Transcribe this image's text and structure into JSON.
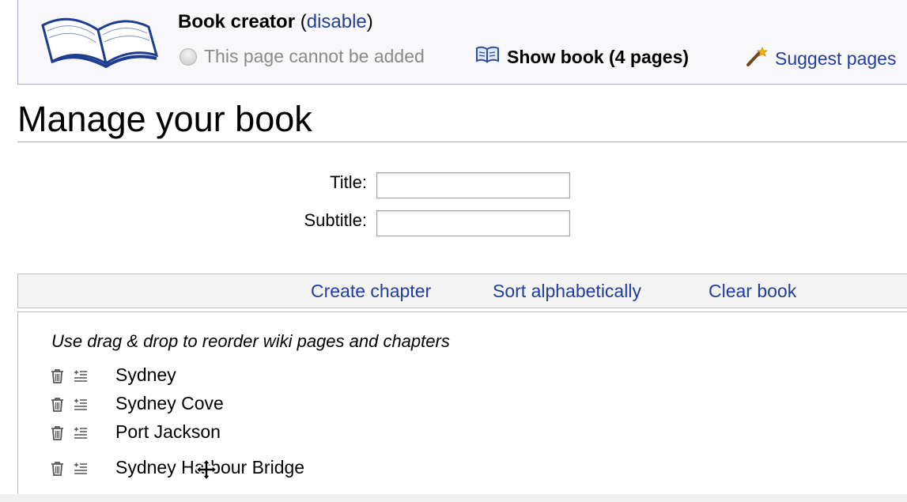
{
  "book_creator": {
    "title": "Book creator",
    "disable_open": "(",
    "disable_link": "disable",
    "disable_close": ")",
    "cannot_add_text": "This page cannot be added",
    "show_book_label": "Show book (4 pages)",
    "suggest_pages_label": "Suggest pages",
    "icons": {
      "logo": "open-book-icon",
      "radio": "radio-disabled-icon",
      "show_book": "book-icon",
      "suggest": "magic-wand-icon"
    }
  },
  "heading": "Manage your book",
  "form": {
    "title_label": "Title:",
    "title_value": "",
    "subtitle_label": "Subtitle:",
    "subtitle_value": ""
  },
  "toolbar": {
    "create_chapter": "Create chapter",
    "sort_alphabetically": "Sort alphabetically",
    "clear_book": "Clear book"
  },
  "list": {
    "hint": "Use drag & drop to reorder wiki pages and chapters",
    "items": [
      {
        "label": "Sydney"
      },
      {
        "label": "Sydney Cove"
      },
      {
        "label": "Port Jackson"
      },
      {
        "label": "Sydney Harbour Bridge"
      }
    ]
  },
  "cursor": "move-cursor",
  "colors": {
    "link": "#223e9c",
    "box_background": "#f8f8fb",
    "box_border": "#aaaabb",
    "toolbar_background": "#f3f3f3"
  }
}
